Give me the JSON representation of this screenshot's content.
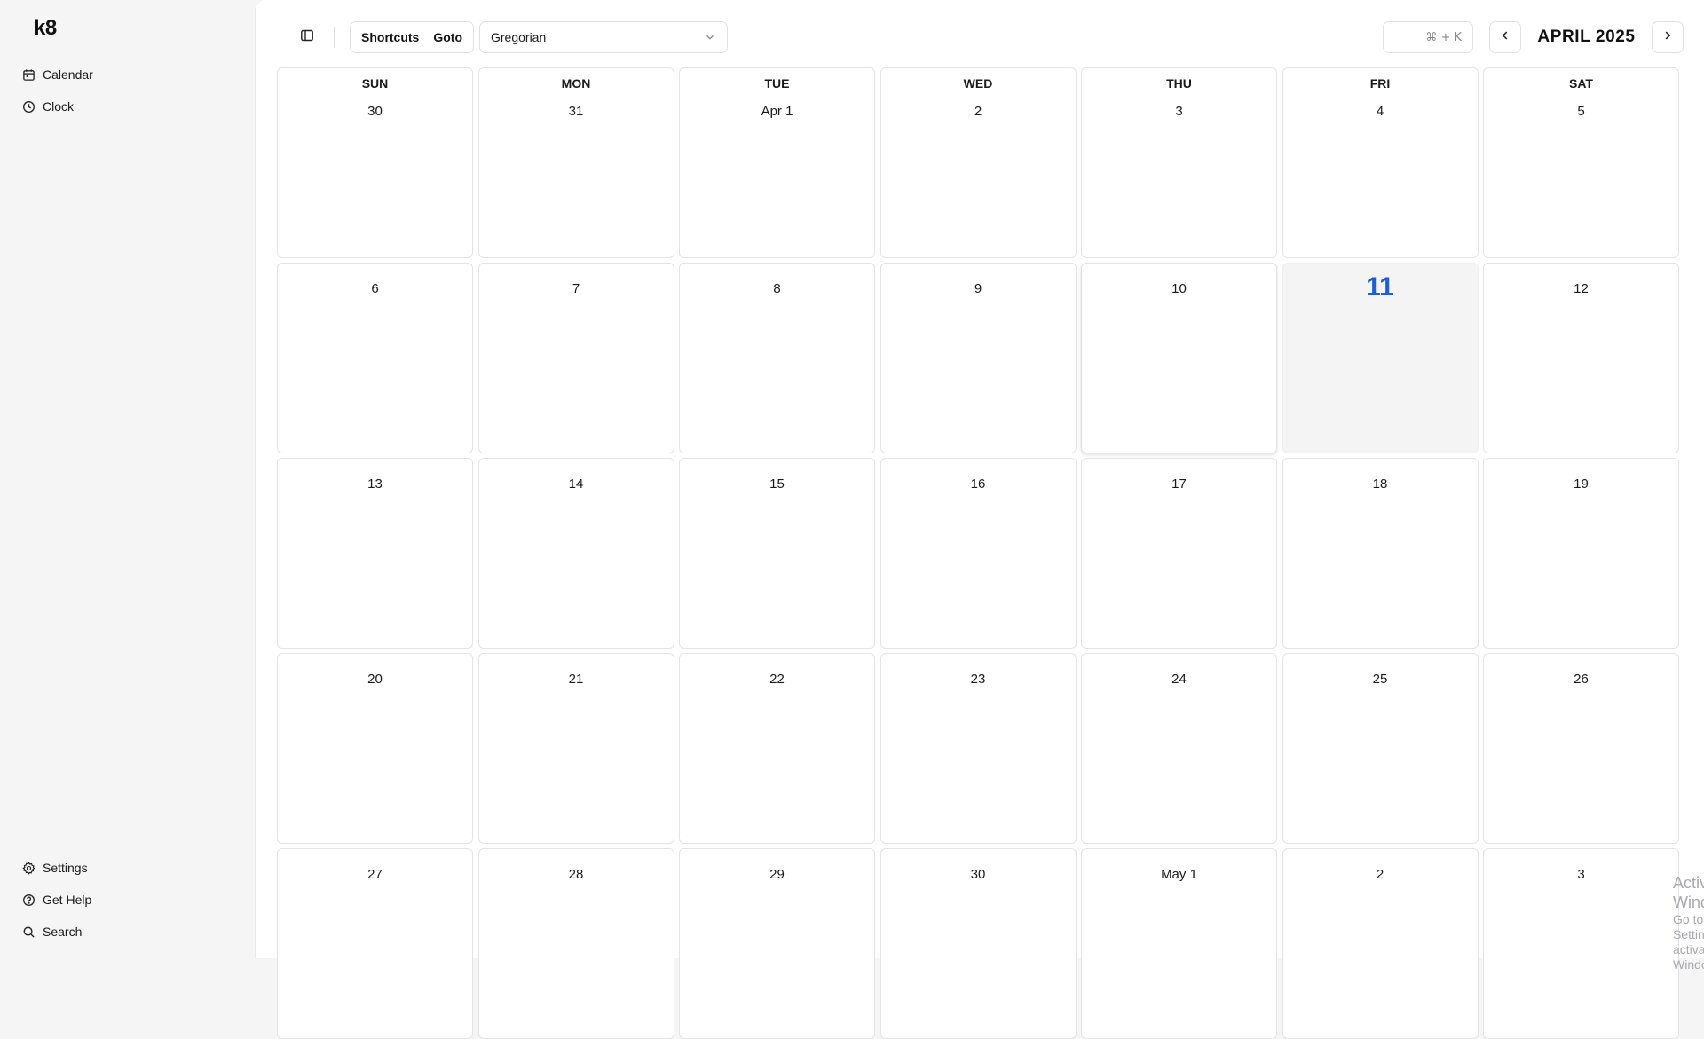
{
  "app": {
    "logo": "k8"
  },
  "sidebar": {
    "top_items": [
      {
        "label": "Calendar",
        "icon": "calendar-icon"
      },
      {
        "label": "Clock",
        "icon": "clock-icon"
      }
    ],
    "bottom_items": [
      {
        "label": "Settings",
        "icon": "gear-icon"
      },
      {
        "label": "Get Help",
        "icon": "help-icon"
      },
      {
        "label": "Search",
        "icon": "search-icon"
      }
    ]
  },
  "toolbar": {
    "shortcuts_label": "Shortcuts",
    "goto_label": "Goto",
    "calendar_system": "Gregorian",
    "search_shortcut": "⌘ + K",
    "month_title": "APRIL 2025"
  },
  "calendar": {
    "weekdays": [
      "SUN",
      "MON",
      "TUE",
      "WED",
      "THU",
      "FRI",
      "SAT"
    ],
    "today_label": "11",
    "weeks": [
      [
        "30",
        "31",
        "Apr 1",
        "2",
        "3",
        "4",
        "5"
      ],
      [
        "6",
        "7",
        "8",
        "9",
        "10",
        "11",
        "12"
      ],
      [
        "13",
        "14",
        "15",
        "16",
        "17",
        "18",
        "19"
      ],
      [
        "20",
        "21",
        "22",
        "23",
        "24",
        "25",
        "26"
      ],
      [
        "27",
        "28",
        "29",
        "30",
        "May 1",
        "2",
        "3"
      ]
    ]
  },
  "watermark": {
    "title": "Activate Windows",
    "subtitle": "Go to Settings to activate Windows."
  },
  "colors": {
    "today_accent": "#1f5fd6",
    "background": "#f5f5f6"
  }
}
